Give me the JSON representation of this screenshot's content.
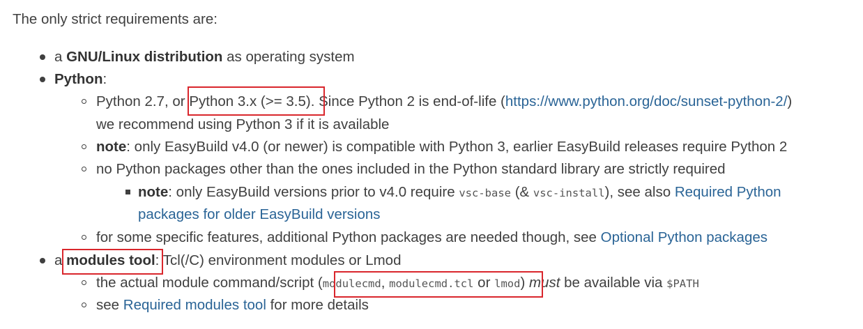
{
  "intro": "The only strict requirements are:",
  "items": {
    "os": {
      "prefix": "a",
      "strong": "GNU/Linux distribution",
      "suffix": "as operating system"
    },
    "python": {
      "strong": "Python",
      "colon": ":",
      "sub1": {
        "text1": "Python 2.7, or",
        "highlight": "Python 3.x (>= 3.5)",
        "text2": ". Since Python 2 is end-of-life (",
        "link": "https://www.python.org/doc/sunset-python-2/",
        "text3": ")",
        "line2": "we recommend using Python 3 if it is available"
      },
      "sub2": {
        "strong": "note",
        "text": ": only EasyBuild v4.0 (or newer) is compatible with Python 3, earlier EasyBuild releases require Python 2"
      },
      "sub3": {
        "text": "no Python packages other than the ones included in the Python standard library are strictly required",
        "subsub": {
          "strong": "note",
          "text1": ": only EasyBuild versions prior to v4.0 require",
          "code1": "vsc-base",
          "text2": "(&",
          "code2": "vsc-install",
          "text3": "), see also",
          "link_line1": "Required Python",
          "link_line2": "packages for older EasyBuild versions"
        }
      },
      "sub4": {
        "text": "for some specific features, additional Python packages are needed though, see",
        "link": "Optional Python packages"
      }
    },
    "modules": {
      "prefix": "a",
      "strong": "modules tool",
      "suffix": ": Tcl(/C) environment modules or Lmod",
      "sub1": {
        "text1": "the actual module command/script (",
        "code1": "modulecmd",
        "comma": ",",
        "code2": "modulecmd.tcl",
        "or": "or",
        "code3": "lmod",
        "text2": ")",
        "em": "must",
        "text3": "be available via",
        "code4": "$PATH"
      },
      "sub2": {
        "text1": "see",
        "link": "Required modules tool",
        "text2": "for more details"
      }
    }
  },
  "colors": {
    "text": "#404040",
    "link": "#2a6496",
    "annotation": "#d9262c"
  }
}
